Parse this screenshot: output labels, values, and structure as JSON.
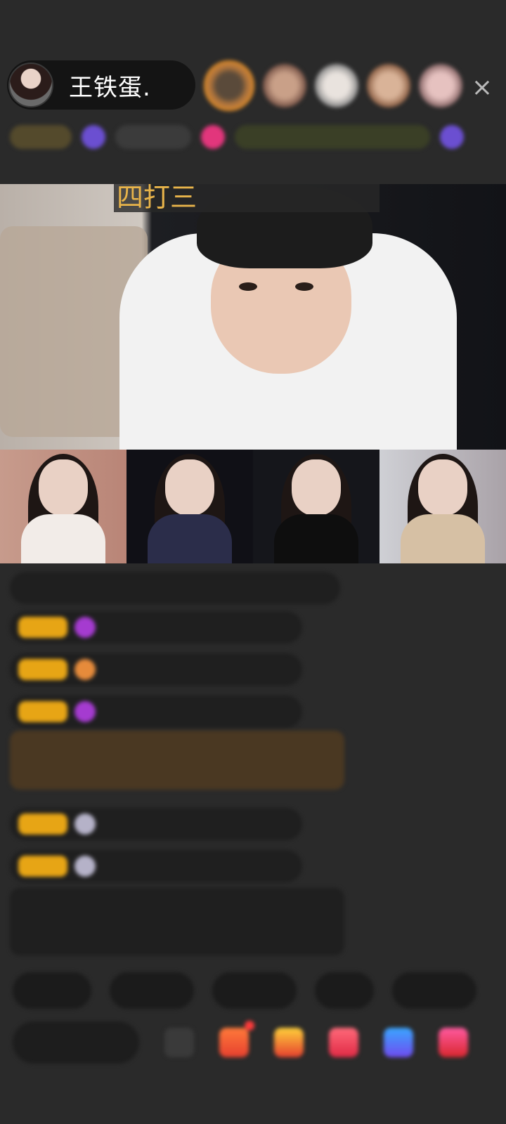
{
  "header": {
    "host_name": "王铁蛋.",
    "close_symbol": "×"
  },
  "video": {
    "title_overlay": "四打三"
  },
  "colors": {
    "background": "#2a2a2a",
    "accent_gold": "#e7a515",
    "notice_green": "#7dbb52"
  }
}
